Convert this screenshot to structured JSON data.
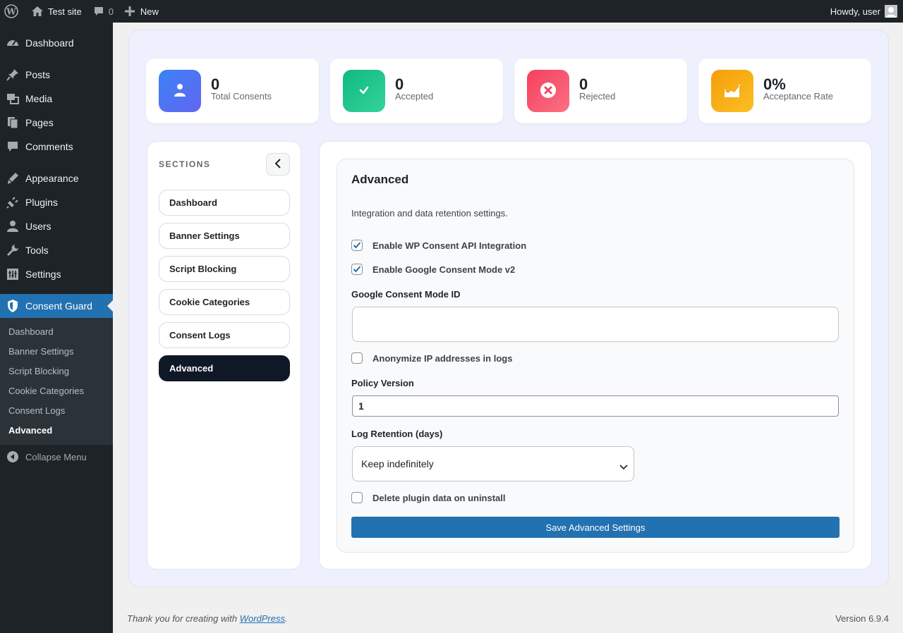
{
  "adminbar": {
    "site_name": "Test site",
    "comments_count": "0",
    "new_label": "New",
    "greeting": "Howdy, user"
  },
  "menu": {
    "items": [
      {
        "label": "Dashboard",
        "icon": "dashboard-icon"
      },
      {
        "label": "Posts",
        "icon": "pin-icon"
      },
      {
        "label": "Media",
        "icon": "media-icon"
      },
      {
        "label": "Pages",
        "icon": "pages-icon"
      },
      {
        "label": "Comments",
        "icon": "comment-icon"
      },
      {
        "label": "Appearance",
        "icon": "brush-icon"
      },
      {
        "label": "Plugins",
        "icon": "plugin-icon"
      },
      {
        "label": "Users",
        "icon": "user-icon"
      },
      {
        "label": "Tools",
        "icon": "wrench-icon"
      },
      {
        "label": "Settings",
        "icon": "settings-icon"
      },
      {
        "label": "Consent Guard",
        "icon": "shield-icon"
      }
    ],
    "submenu": [
      "Dashboard",
      "Banner Settings",
      "Script Blocking",
      "Cookie Categories",
      "Consent Logs",
      "Advanced"
    ],
    "collapse_label": "Collapse Menu"
  },
  "stats": [
    {
      "value": "0",
      "label": "Total Consents",
      "color_from": "#3b82f6",
      "color_to": "#6366f1"
    },
    {
      "value": "0",
      "label": "Accepted",
      "color_from": "#10b981",
      "color_to": "#34d399"
    },
    {
      "value": "0",
      "label": "Rejected",
      "color_from": "#f43f5e",
      "color_to": "#fb7185"
    },
    {
      "value": "0%",
      "label": "Acceptance Rate",
      "color_from": "#f59e0b",
      "color_to": "#fbbf24"
    }
  ],
  "sections": {
    "title": "SECTIONS",
    "items": [
      "Dashboard",
      "Banner Settings",
      "Script Blocking",
      "Cookie Categories",
      "Consent Logs",
      "Advanced"
    ],
    "active": "Advanced"
  },
  "advanced": {
    "title": "Advanced",
    "description": "Integration and data retention settings.",
    "wp_consent_api_label": "Enable WP Consent API Integration",
    "wp_consent_api_checked": true,
    "google_consent_label": "Enable Google Consent Mode v2",
    "google_consent_checked": true,
    "gcm_id_label": "Google Consent Mode ID",
    "gcm_id_value": "",
    "anonymize_label": "Anonymize IP addresses in logs",
    "anonymize_checked": false,
    "policy_version_label": "Policy Version",
    "policy_version_value": "1",
    "retention_label": "Log Retention (days)",
    "retention_value": "Keep indefinitely",
    "delete_data_label": "Delete plugin data on uninstall",
    "delete_data_checked": false,
    "save_label": "Save Advanced Settings"
  },
  "footer": {
    "thanks_prefix": "Thank you for creating with ",
    "thanks_link": "WordPress",
    "thanks_suffix": ".",
    "version": "Version 6.9.4"
  },
  "colors": {
    "admin_dark": "#1d2327",
    "accent": "#2271b1",
    "panel_bg": "#eef1fd",
    "active_section": "#101828"
  }
}
